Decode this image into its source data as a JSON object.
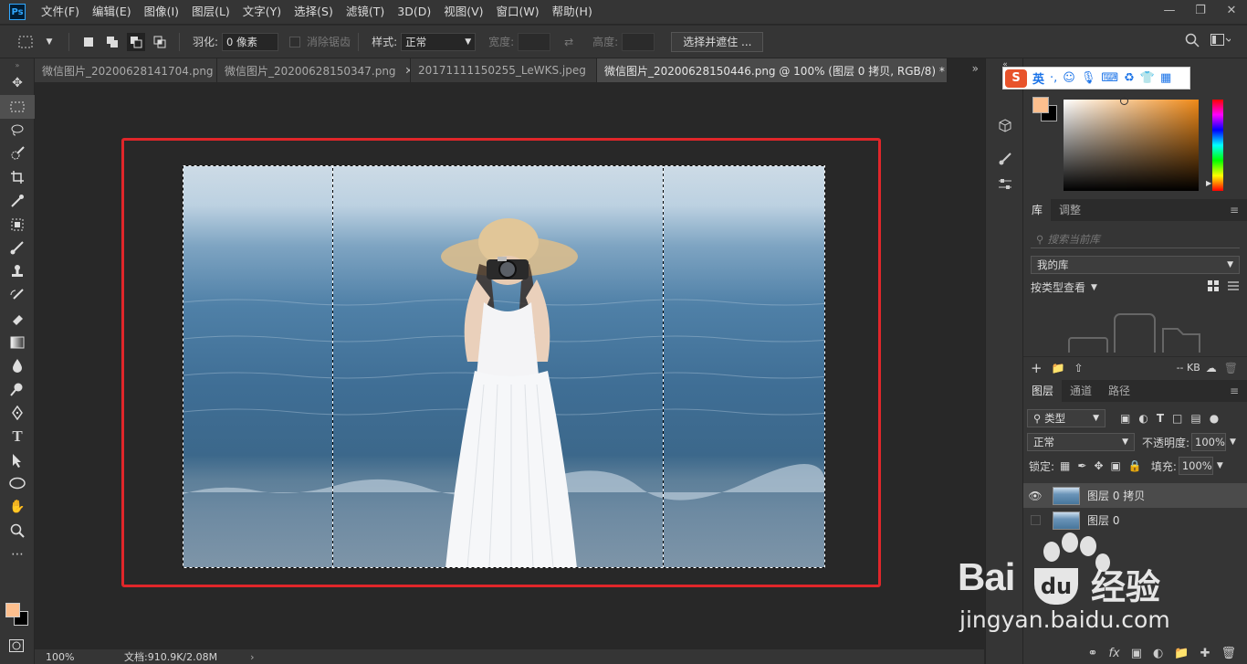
{
  "app": {
    "logo": "Ps"
  },
  "menu": [
    "文件(F)",
    "编辑(E)",
    "图像(I)",
    "图层(L)",
    "文字(Y)",
    "选择(S)",
    "滤镜(T)",
    "3D(D)",
    "视图(V)",
    "窗口(W)",
    "帮助(H)"
  ],
  "options": {
    "feather_label": "羽化:",
    "feather_value": "0 像素",
    "antialias_label": "消除锯齿",
    "style_label": "样式:",
    "style_value": "正常",
    "width_label": "宽度:",
    "height_label": "高度:",
    "select_mask_btn": "选择并遮住 ..."
  },
  "doc_tabs": [
    {
      "label": "微信图片_20200628141704.png"
    },
    {
      "label": "微信图片_20200628150347.png"
    },
    {
      "label": "20171111150255_LeWKS.jpeg"
    },
    {
      "label": "微信图片_20200628150446.png @ 100% (图层 0 拷贝, RGB/8) *"
    }
  ],
  "status": {
    "zoom": "100%",
    "doc": "文档:910.9K/2.08M"
  },
  "ime": {
    "brand": "S",
    "lang": "英"
  },
  "library": {
    "tab_lib": "库",
    "tab_adjust": "调整",
    "search_placeholder": "搜索当前库",
    "my_lib": "我的库",
    "view_by": "按类型查看",
    "size": "-- KB"
  },
  "layers": {
    "tab_layers": "图层",
    "tab_channels": "通道",
    "tab_paths": "路径",
    "filter_kind": "类型",
    "blend_mode": "正常",
    "opacity_label": "不透明度:",
    "opacity_value": "100%",
    "lock_label": "锁定:",
    "fill_label": "填充:",
    "fill_value": "100%",
    "items": [
      {
        "name": "图层 0 拷贝"
      },
      {
        "name": "图层 0"
      }
    ]
  },
  "watermark": {
    "brand": "Bai",
    "brand2": "经验",
    "url": "jingyan.baidu.com"
  },
  "colors": {
    "foreground": "#fcbf8e",
    "background": "#000000",
    "frame": "#e0262a"
  }
}
